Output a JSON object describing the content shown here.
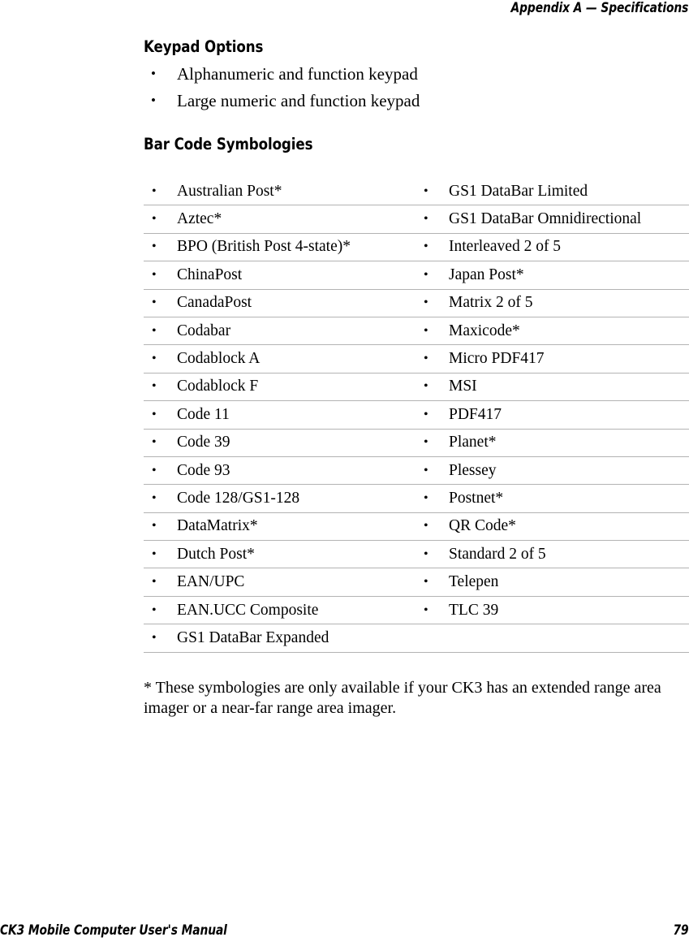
{
  "header": {
    "running_head": "Appendix A — Specifications"
  },
  "footer": {
    "manual_title": "CK3 Mobile Computer User's Manual",
    "page_number": "79"
  },
  "sections": {
    "keypad": {
      "heading": "Keypad Options",
      "bullet": "•",
      "items": [
        "Alphanumeric and function keypad",
        "Large numeric and function keypad"
      ]
    },
    "symbologies": {
      "heading": "Bar Code Symbologies",
      "bullet": "•",
      "rows": [
        {
          "left": "Australian Post*",
          "right": "GS1 DataBar Limited"
        },
        {
          "left": "Aztec*",
          "right": "GS1 DataBar Omnidirectional"
        },
        {
          "left": "BPO (British Post 4-state)*",
          "right": "Interleaved 2 of 5"
        },
        {
          "left": "ChinaPost",
          "right": "Japan Post*"
        },
        {
          "left": "CanadaPost",
          "right": "Matrix 2 of 5"
        },
        {
          "left": "Codabar",
          "right": "Maxicode*"
        },
        {
          "left": "Codablock A",
          "right": "Micro PDF417"
        },
        {
          "left": "Codablock F",
          "right": "MSI"
        },
        {
          "left": "Code 11",
          "right": "PDF417"
        },
        {
          "left": "Code 39",
          "right": "Planet*"
        },
        {
          "left": "Code 93",
          "right": "Plessey"
        },
        {
          "left": "Code 128/GS1-128",
          "right": "Postnet*"
        },
        {
          "left": "DataMatrix*",
          "right": "QR Code*"
        },
        {
          "left": "Dutch Post*",
          "right": "Standard 2 of 5"
        },
        {
          "left": "EAN/UPC",
          "right": "Telepen"
        },
        {
          "left": "EAN.UCC Composite",
          "right": "TLC 39"
        },
        {
          "left": "GS1 DataBar Expanded",
          "right": ""
        }
      ],
      "footnote": "* These symbologies are only available if your CK3 has an extended range area imager or a near-far range area imager."
    }
  },
  "colors": {
    "text": "#000000",
    "rule": "#b3b3b3",
    "page_background": "#ffffff"
  }
}
